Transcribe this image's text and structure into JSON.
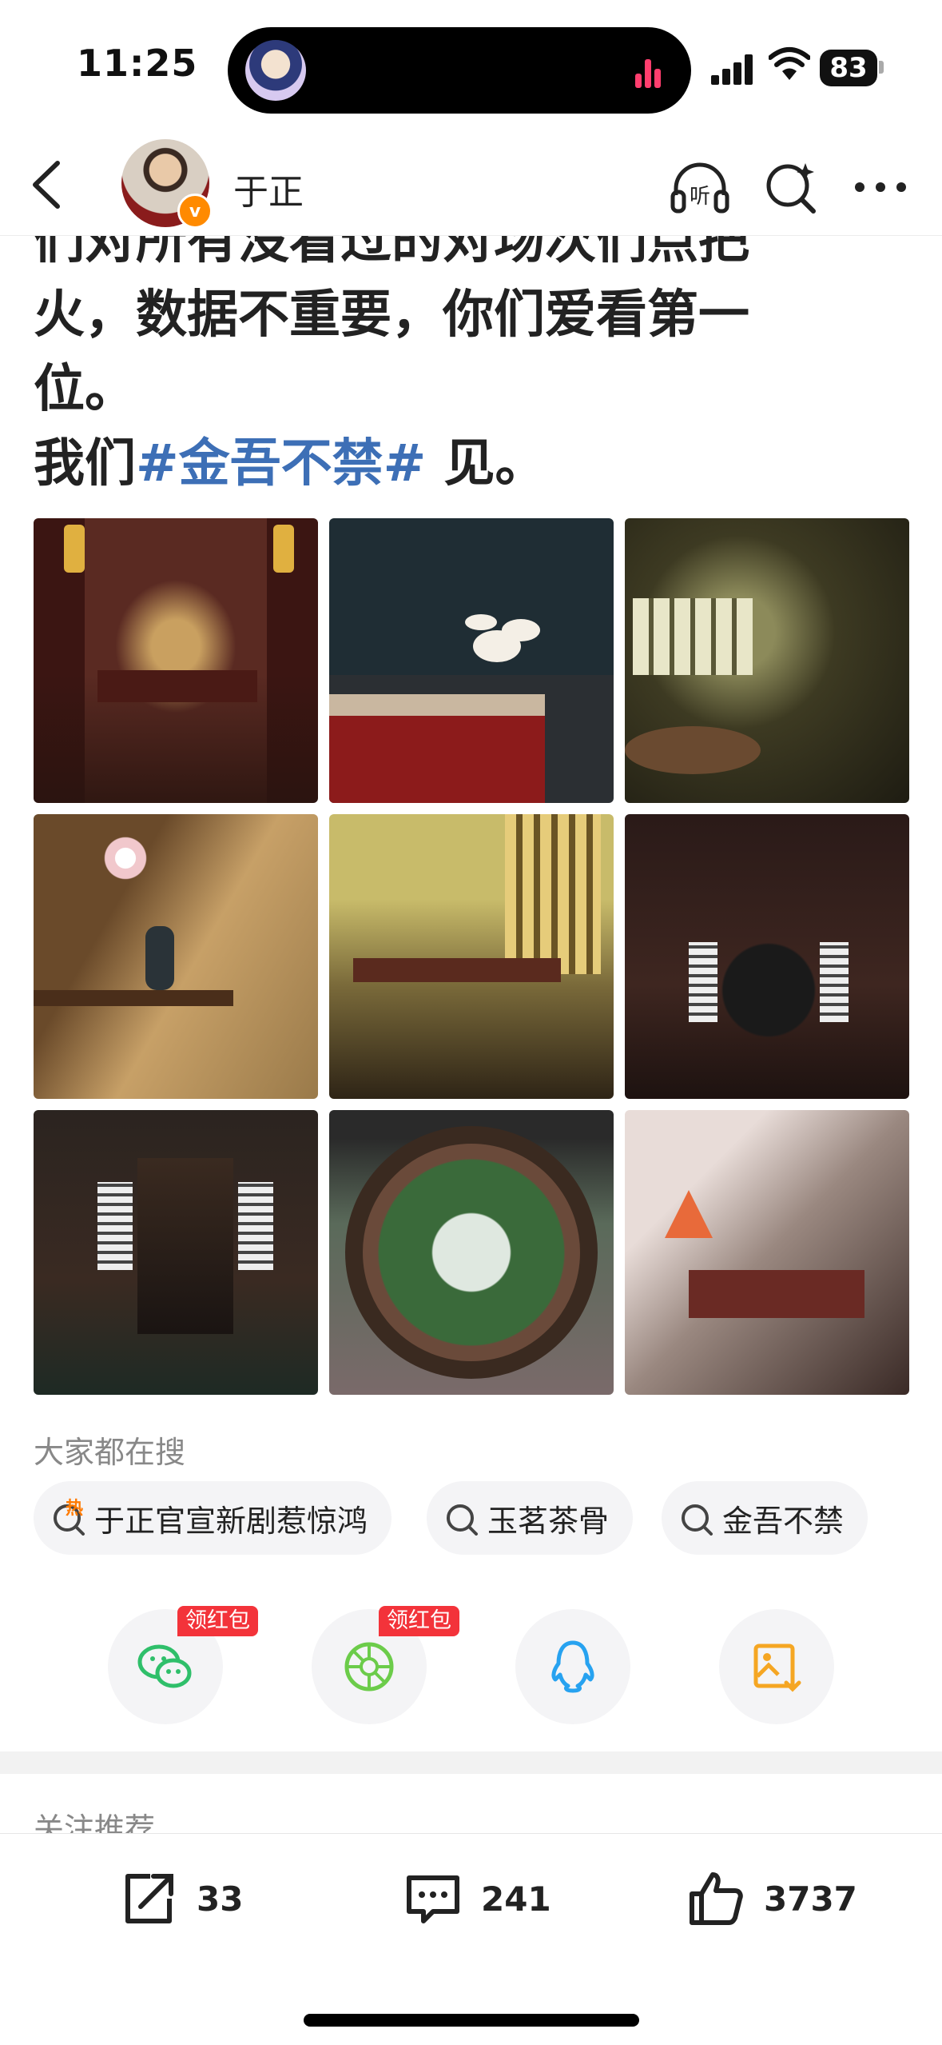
{
  "status_bar": {
    "time": "11:25",
    "battery": "83"
  },
  "header": {
    "username": "于正"
  },
  "post": {
    "lines": [
      "们对所有没看过的对场次们点把",
      "火，数据不重要，你们爱看第一",
      "位。"
    ],
    "last_line_prefix": "我们",
    "hashtag": "#金吾不禁#",
    "last_line_suffix": " 见。"
  },
  "images": [
    {
      "name": "palace-hall-throne"
    },
    {
      "name": "tablecloth-plum-blossom"
    },
    {
      "name": "window-round-table"
    },
    {
      "name": "vase-flowers-console"
    },
    {
      "name": "chairs-sunlit-lattice"
    },
    {
      "name": "lantern-cabinet-dark"
    },
    {
      "name": "pagoda-cabinet"
    },
    {
      "name": "moon-gate-garden"
    },
    {
      "name": "tea-table-misty"
    }
  ],
  "search": {
    "label": "大家都在搜",
    "chips": [
      "于正官宣新剧惹惊鸿",
      "玉茗茶骨",
      "金吾不禁"
    ],
    "hot_badge": "热"
  },
  "share": {
    "items": [
      "wechat",
      "moments",
      "qq",
      "save-image"
    ],
    "red_tag": "领红包"
  },
  "follow_label": "关注推荐",
  "actions": {
    "reposts": "33",
    "comments": "241",
    "likes": "3737"
  },
  "colors": {
    "accent": "#3d6fb6",
    "hot": "#f3333a",
    "verified": "#ff8a00"
  }
}
